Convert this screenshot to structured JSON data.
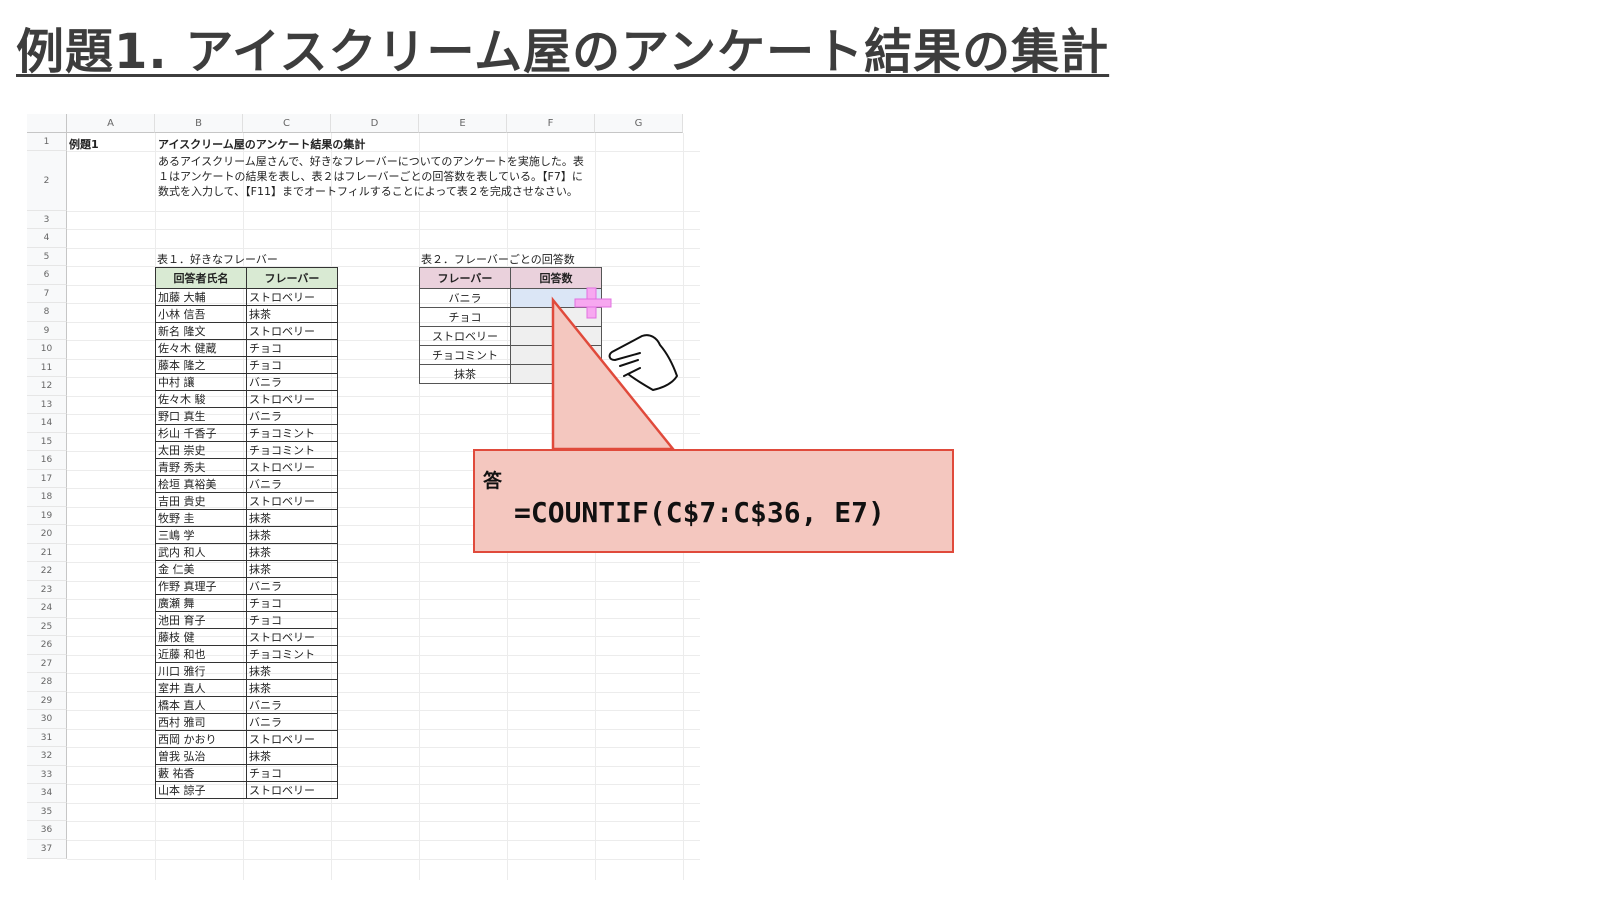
{
  "slide": {
    "title": "例題1. アイスクリーム屋のアンケート結果の集計"
  },
  "sheet": {
    "columns": [
      "A",
      "B",
      "C",
      "D",
      "E",
      "F",
      "G"
    ],
    "rows": [
      "1",
      "2",
      "3",
      "4",
      "5",
      "6",
      "7",
      "8",
      "9",
      "10",
      "11",
      "12",
      "13",
      "14",
      "15",
      "16",
      "17",
      "18",
      "19",
      "20",
      "21",
      "22",
      "23",
      "24",
      "25",
      "26",
      "27",
      "28",
      "29",
      "30",
      "31",
      "32",
      "33",
      "34",
      "35",
      "36",
      "37"
    ],
    "a1": "例題1",
    "b1": "アイスクリーム屋のアンケート結果の集計",
    "description": "あるアイスクリーム屋さんで、好きなフレーバーについてのアンケートを実施した。表１はアンケートの結果を表し、表２はフレーバーごとの回答数を表している。【F7】に数式を入力して、【F11】までオートフィルすることによって表２を完成させなさい。",
    "table1": {
      "caption": "表１．好きなフレーバー",
      "headers": [
        "回答者氏名",
        "フレーバー"
      ],
      "rows": [
        [
          "加藤 大輔",
          "ストロベリー"
        ],
        [
          "小林 信吾",
          "抹茶"
        ],
        [
          "新名 隆文",
          "ストロベリー"
        ],
        [
          "佐々木 健蔵",
          "チョコ"
        ],
        [
          "藤本 隆之",
          "チョコ"
        ],
        [
          "中村 讓",
          "バニラ"
        ],
        [
          "佐々木 駿",
          "ストロベリー"
        ],
        [
          "野口 真生",
          "バニラ"
        ],
        [
          "杉山 千香子",
          "チョコミント"
        ],
        [
          "太田 崇史",
          "チョコミント"
        ],
        [
          "青野 秀夫",
          "ストロベリー"
        ],
        [
          "桧垣 真裕美",
          "バニラ"
        ],
        [
          "吉田 貴史",
          "ストロベリー"
        ],
        [
          "牧野 圭",
          "抹茶"
        ],
        [
          "三嶋 学",
          "抹茶"
        ],
        [
          "武内 和人",
          "抹茶"
        ],
        [
          "金 仁美",
          "抹茶"
        ],
        [
          "作野 真理子",
          "バニラ"
        ],
        [
          "廣瀬 舞",
          "チョコ"
        ],
        [
          "池田 育子",
          "チョコ"
        ],
        [
          "藤枝 健",
          "ストロベリー"
        ],
        [
          "近藤 和也",
          "チョコミント"
        ],
        [
          "川口 雅行",
          "抹茶"
        ],
        [
          "室井 直人",
          "抹茶"
        ],
        [
          "橋本 直人",
          "バニラ"
        ],
        [
          "西村 雅司",
          "バニラ"
        ],
        [
          "西岡 かおり",
          "ストロベリー"
        ],
        [
          "曽我 弘治",
          "抹茶"
        ],
        [
          "藪 祐香",
          "チョコ"
        ],
        [
          "山本 諒子",
          "ストロベリー"
        ]
      ]
    },
    "table2": {
      "caption": "表２．フレーバーごとの回答数",
      "headers": [
        "フレーバー",
        "回答数"
      ],
      "rows": [
        "バニラ",
        "チョコ",
        "ストロベリー",
        "チョコミント",
        "抹茶"
      ]
    }
  },
  "callout": {
    "label": "答",
    "formula": "=COUNTIF(C$7:C$36, E7)"
  },
  "colors": {
    "callout_fill": "#f4c7bf",
    "callout_border": "#e04a3b",
    "table1_header": "#d9ead3",
    "table2_header": "#ead1dc",
    "cursor": "#ee77ee"
  },
  "icons": {
    "cursor": "crosshair-cursor-icon",
    "hand": "pointing-hand-icon"
  }
}
